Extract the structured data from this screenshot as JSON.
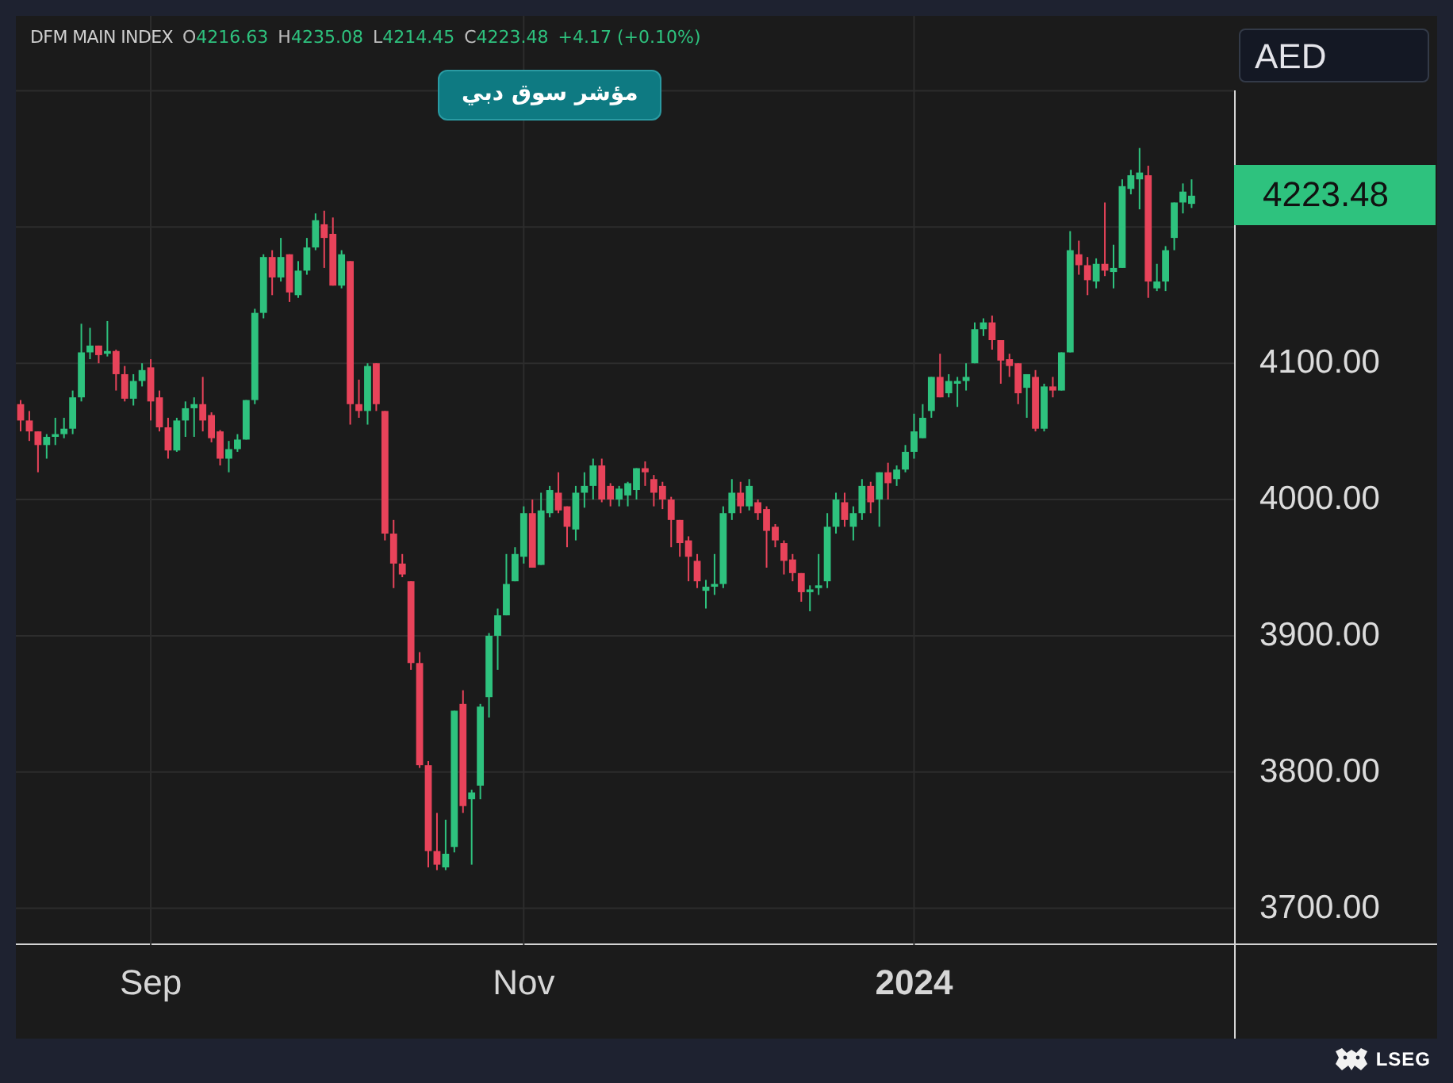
{
  "legend": {
    "fields": [
      {
        "letter": "O",
        "value": "4216.63"
      },
      {
        "letter": "H",
        "value": "4235.08"
      },
      {
        "letter": "L",
        "value": "4214.45"
      },
      {
        "letter": "C",
        "value": "4223.48"
      }
    ],
    "change": "+4.17 (+0.10%)"
  },
  "badge": "مؤشر سوق دبي",
  "currency": "AED",
  "last_price": "4223.48",
  "chart_data": {
    "type": "candlestick",
    "title": "DFM MAIN INDEX",
    "grid": true,
    "ylim": [
      3673,
      4355
    ],
    "yticks": [
      {
        "value": 3700,
        "label": "3700.00"
      },
      {
        "value": 3800,
        "label": "3800.00"
      },
      {
        "value": 3900,
        "label": "3900.00"
      },
      {
        "value": 4000,
        "label": "4000.00"
      },
      {
        "value": 4100,
        "label": "4100.00"
      }
    ],
    "categories": [
      null,
      null,
      null,
      null,
      null,
      null,
      null,
      null,
      null,
      null,
      null,
      null,
      null,
      null,
      null,
      "Sep",
      null,
      null,
      null,
      null,
      null,
      null,
      null,
      null,
      null,
      null,
      null,
      null,
      null,
      null,
      null,
      null,
      null,
      null,
      null,
      null,
      null,
      null,
      null,
      null,
      null,
      null,
      null,
      null,
      null,
      null,
      null,
      null,
      null,
      null,
      null,
      null,
      null,
      null,
      null,
      null,
      null,
      null,
      "Nov",
      null,
      null,
      null,
      null,
      null,
      null,
      null,
      null,
      null,
      null,
      null,
      null,
      null,
      null,
      null,
      null,
      null,
      null,
      null,
      null,
      null,
      null,
      null,
      null,
      null,
      null,
      null,
      null,
      null,
      null,
      null,
      null,
      null,
      null,
      null,
      null,
      null,
      null,
      null,
      null,
      null,
      null,
      null,
      null,
      "2024",
      null,
      null,
      null,
      null,
      null,
      null,
      null,
      null,
      null,
      null,
      null,
      null,
      null,
      null,
      null,
      null,
      null,
      null,
      null,
      null,
      null,
      null,
      null,
      null,
      null,
      null,
      null,
      null,
      null,
      null,
      null,
      null
    ],
    "ohlc": [
      [
        4070,
        4073,
        4050,
        4058
      ],
      [
        4058,
        4065,
        4043,
        4050
      ],
      [
        4050,
        4050,
        4020,
        4040
      ],
      [
        4040,
        4048,
        4030,
        4046
      ],
      [
        4046,
        4060,
        4040,
        4048
      ],
      [
        4048,
        4060,
        4045,
        4052
      ],
      [
        4052,
        4080,
        4048,
        4075
      ],
      [
        4075,
        4129,
        4072,
        4108
      ],
      [
        4108,
        4126,
        4103,
        4113
      ],
      [
        4113,
        4113,
        4100,
        4106
      ],
      [
        4107,
        4131,
        4105,
        4109
      ],
      [
        4109,
        4110,
        4080,
        4092
      ],
      [
        4092,
        4098,
        4072,
        4074
      ],
      [
        4074,
        4092,
        4069,
        4087
      ],
      [
        4087,
        4100,
        4083,
        4095
      ],
      [
        4097,
        4103,
        4058,
        4072
      ],
      [
        4075,
        4080,
        4050,
        4053
      ],
      [
        4053,
        4060,
        4030,
        4036
      ],
      [
        4036,
        4060,
        4035,
        4058
      ],
      [
        4058,
        4072,
        4046,
        4067
      ],
      [
        4067,
        4075,
        4046,
        4070
      ],
      [
        4070,
        4090,
        4050,
        4058
      ],
      [
        4062,
        4064,
        4042,
        4045
      ],
      [
        4050,
        4051,
        4025,
        4030
      ],
      [
        4030,
        4043,
        4020,
        4037
      ],
      [
        4037,
        4048,
        4035,
        4044
      ],
      [
        4044,
        4073,
        4044,
        4073
      ],
      [
        4073,
        4140,
        4070,
        4137
      ],
      [
        4137,
        4180,
        4133,
        4178
      ],
      [
        4178,
        4183,
        4150,
        4163
      ],
      [
        4163,
        4192,
        4160,
        4178
      ],
      [
        4180,
        4180,
        4145,
        4152
      ],
      [
        4150,
        4175,
        4148,
        4168
      ],
      [
        4168,
        4192,
        4165,
        4185
      ],
      [
        4185,
        4210,
        4183,
        4205
      ],
      [
        4202,
        4212,
        4170,
        4192
      ],
      [
        4195,
        4207,
        4157,
        4157
      ],
      [
        4157,
        4183,
        4155,
        4180
      ],
      [
        4175,
        4175,
        4055,
        4070
      ],
      [
        4070,
        4088,
        4060,
        4065
      ],
      [
        4065,
        4100,
        4055,
        4098
      ],
      [
        4100,
        4100,
        4065,
        4070
      ],
      [
        4065,
        4065,
        3970,
        3975
      ],
      [
        3975,
        3985,
        3935,
        3953
      ],
      [
        3953,
        3960,
        3943,
        3945
      ],
      [
        3940,
        3940,
        3875,
        3880
      ],
      [
        3880,
        3888,
        3803,
        3805
      ],
      [
        3805,
        3808,
        3730,
        3742
      ],
      [
        3742,
        3770,
        3728,
        3732
      ],
      [
        3730,
        3765,
        3728,
        3740
      ],
      [
        3745,
        3845,
        3741,
        3845
      ],
      [
        3850,
        3860,
        3770,
        3775
      ],
      [
        3780,
        3787,
        3732,
        3785
      ],
      [
        3790,
        3850,
        3780,
        3848
      ],
      [
        3855,
        3902,
        3840,
        3900
      ],
      [
        3900,
        3920,
        3875,
        3915
      ],
      [
        3915,
        3960,
        3915,
        3938
      ],
      [
        3940,
        3965,
        3940,
        3960
      ],
      [
        3958,
        3995,
        3953,
        3990
      ],
      [
        3990,
        4000,
        3950,
        3950
      ],
      [
        3952,
        4005,
        3952,
        3992
      ],
      [
        3990,
        4010,
        3987,
        4007
      ],
      [
        4005,
        4020,
        3990,
        3992
      ],
      [
        3995,
        3995,
        3965,
        3980
      ],
      [
        3978,
        4010,
        3970,
        4005
      ],
      [
        4005,
        4020,
        3994,
        4010
      ],
      [
        4010,
        4030,
        4000,
        4025
      ],
      [
        4025,
        4030,
        3998,
        4000
      ],
      [
        4010,
        4012,
        3995,
        4000
      ],
      [
        4000,
        4010,
        3995,
        4008
      ],
      [
        4003,
        4013,
        3995,
        4012
      ],
      [
        4007,
        4023,
        4000,
        4023
      ],
      [
        4023,
        4028,
        4010,
        4020
      ],
      [
        4015,
        4018,
        3995,
        4005
      ],
      [
        4010,
        4013,
        3993,
        4000
      ],
      [
        4000,
        4002,
        3965,
        3985
      ],
      [
        3985,
        3985,
        3958,
        3968
      ],
      [
        3970,
        3973,
        3940,
        3958
      ],
      [
        3955,
        3960,
        3935,
        3940
      ],
      [
        3933,
        3941,
        3920,
        3936
      ],
      [
        3936,
        3960,
        3930,
        3938
      ],
      [
        3938,
        3995,
        3935,
        3990
      ],
      [
        3990,
        4015,
        3985,
        4005
      ],
      [
        4005,
        4013,
        3990,
        3995
      ],
      [
        3995,
        4015,
        3992,
        4010
      ],
      [
        3998,
        4000,
        3985,
        3990
      ],
      [
        3993,
        3995,
        3950,
        3977
      ],
      [
        3980,
        3982,
        3965,
        3970
      ],
      [
        3968,
        3970,
        3945,
        3955
      ],
      [
        3956,
        3960,
        3940,
        3946
      ],
      [
        3946,
        3946,
        3925,
        3932
      ],
      [
        3932,
        3937,
        3918,
        3934
      ],
      [
        3935,
        3960,
        3930,
        3937
      ],
      [
        3940,
        3990,
        3935,
        3980
      ],
      [
        3980,
        4005,
        3975,
        4000
      ],
      [
        3998,
        4005,
        3980,
        3985
      ],
      [
        3980,
        3995,
        3970,
        3990
      ],
      [
        3990,
        4015,
        3985,
        4010
      ],
      [
        4010,
        4013,
        3990,
        3998
      ],
      [
        4000,
        4020,
        3980,
        4020
      ],
      [
        4020,
        4027,
        4000,
        4012
      ],
      [
        4015,
        4025,
        4010,
        4022
      ],
      [
        4022,
        4040,
        4020,
        4035
      ],
      [
        4035,
        4063,
        4030,
        4050
      ],
      [
        4045,
        4070,
        4045,
        4060
      ],
      [
        4065,
        4090,
        4060,
        4090
      ],
      [
        4090,
        4107,
        4075,
        4075
      ],
      [
        4078,
        4092,
        4075,
        4087
      ],
      [
        4085,
        4090,
        4068,
        4087
      ],
      [
        4087,
        4100,
        4080,
        4090
      ],
      [
        4100,
        4130,
        4100,
        4125
      ],
      [
        4125,
        4133,
        4120,
        4130
      ],
      [
        4130,
        4135,
        4110,
        4117
      ],
      [
        4117,
        4117,
        4085,
        4102
      ],
      [
        4103,
        4107,
        4090,
        4098
      ],
      [
        4100,
        4100,
        4070,
        4078
      ],
      [
        4082,
        4092,
        4060,
        4092
      ],
      [
        4090,
        4095,
        4050,
        4052
      ],
      [
        4052,
        4085,
        4050,
        4083
      ],
      [
        4083,
        4090,
        4075,
        4080
      ],
      [
        4080,
        4108,
        4080,
        4108
      ],
      [
        4108,
        4197,
        4108,
        4183
      ],
      [
        4180,
        4190,
        4165,
        4172
      ],
      [
        4172,
        4178,
        4150,
        4161
      ],
      [
        4160,
        4177,
        4155,
        4173
      ],
      [
        4173,
        4218,
        4164,
        4168
      ],
      [
        4167,
        4187,
        4155,
        4170
      ],
      [
        4170,
        4235,
        4170,
        4230
      ],
      [
        4228,
        4242,
        4224,
        4238
      ],
      [
        4235,
        4258,
        4213,
        4240
      ],
      [
        4238,
        4245,
        4148,
        4160
      ],
      [
        4155,
        4173,
        4153,
        4160
      ],
      [
        4160,
        4186,
        4153,
        4183
      ],
      [
        4192,
        4218,
        4183,
        4218
      ],
      [
        4218,
        4232,
        4210,
        4226
      ],
      [
        4217,
        4235,
        4214,
        4223
      ]
    ]
  },
  "brand": "LSEG"
}
